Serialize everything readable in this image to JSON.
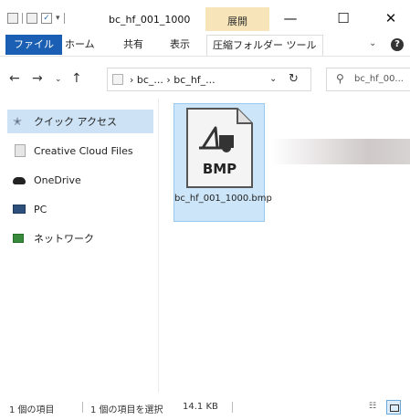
{
  "window": {
    "title": "bc_hf_001_1000",
    "context_tab": "展開",
    "minimize_glyph": "—",
    "maximize_glyph": "☐",
    "close_glyph": "✕"
  },
  "ribbon": {
    "tabs": [
      {
        "label": "ファイル"
      },
      {
        "label": "ホーム"
      },
      {
        "label": "共有"
      },
      {
        "label": "表示"
      },
      {
        "label": "圧縮フォルダー ツール"
      }
    ],
    "collapse_glyph": "⌄",
    "help_glyph": "?"
  },
  "nav": {
    "back_glyph": "←",
    "forward_glyph": "→",
    "recent_glyph": "⌄",
    "up_glyph": "↑",
    "breadcrumb": "› bc_...  › bc_hf_...",
    "address_dropdown_glyph": "⌄",
    "refresh_glyph": "↻",
    "search_glyph": "⚲",
    "search_placeholder": "bc_hf_00..."
  },
  "sidebar": {
    "items": [
      {
        "label": "クイック アクセス",
        "icon": "pin-star-icon"
      },
      {
        "label": "Creative Cloud Files",
        "icon": "creative-cloud-icon"
      },
      {
        "label": "OneDrive",
        "icon": "cloud-icon"
      },
      {
        "label": "PC",
        "icon": "computer-icon"
      },
      {
        "label": "ネットワーク",
        "icon": "network-icon"
      }
    ]
  },
  "files": [
    {
      "name": "bc_hf_001_1000.bmp",
      "type_label": "BMP",
      "selected": true
    }
  ],
  "status": {
    "item_count": "1 個の項目",
    "selected_info": "1 個の項目を選択",
    "size": "14.1 KB"
  },
  "colors": {
    "file_tab": "#1a5fb4",
    "context_tab": "#f7e4b8",
    "selection": "#cce5f8",
    "sidebar_selection": "#cde2f5"
  }
}
